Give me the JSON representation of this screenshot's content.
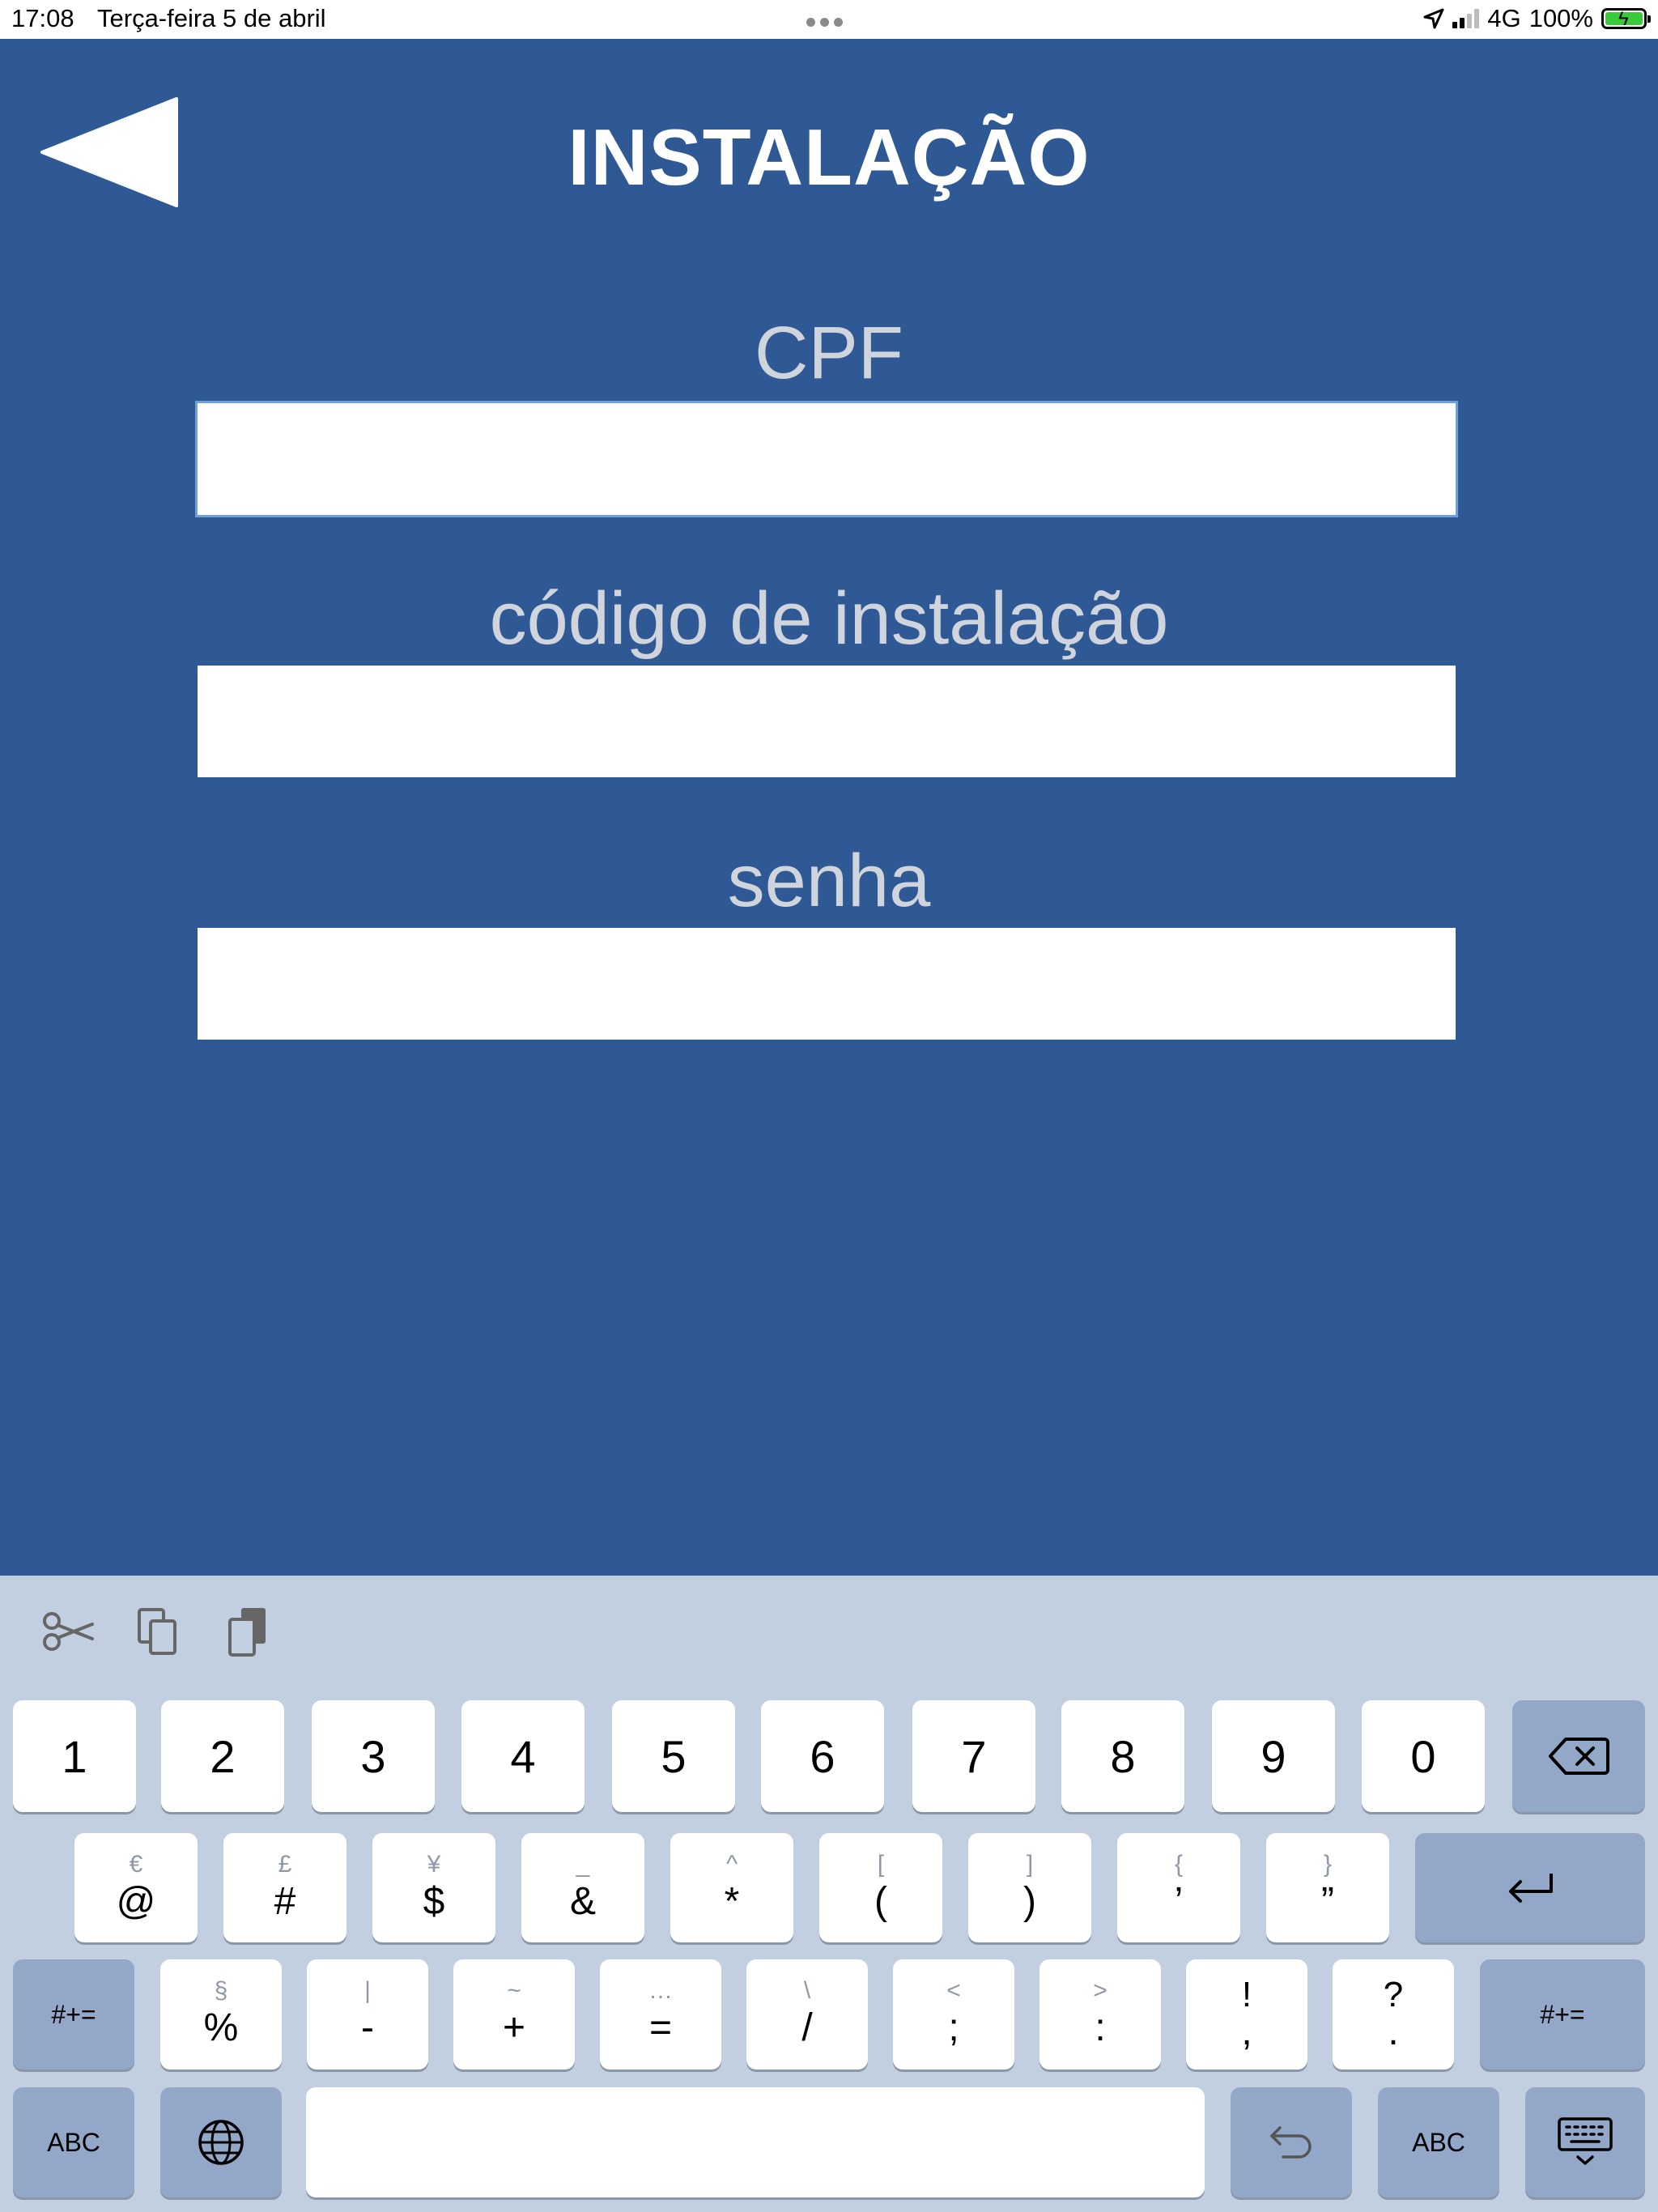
{
  "status_bar": {
    "time": "17:08",
    "date": "Terça-feira 5 de abril",
    "network": "4G",
    "battery": "100%"
  },
  "header": {
    "title": "INSTALAÇÃO",
    "back_icon": "back-triangle-icon"
  },
  "form": {
    "fields": [
      {
        "label": "CPF",
        "value": ""
      },
      {
        "label": "código de instalação",
        "value": ""
      },
      {
        "label": "senha",
        "value": ""
      }
    ]
  },
  "keyboard": {
    "shortcuts": [
      "scissors-icon",
      "copy-icon",
      "paste-icon"
    ],
    "row1": [
      "1",
      "2",
      "3",
      "4",
      "5",
      "6",
      "7",
      "8",
      "9",
      "0"
    ],
    "row2": [
      {
        "alt": "€",
        "main": "@"
      },
      {
        "alt": "£",
        "main": "#"
      },
      {
        "alt": "¥",
        "main": "$"
      },
      {
        "alt": "_",
        "main": "&"
      },
      {
        "alt": "^",
        "main": "*"
      },
      {
        "alt": "[",
        "main": "("
      },
      {
        "alt": "]",
        "main": ")"
      },
      {
        "alt": "{",
        "main": "’"
      },
      {
        "alt": "}",
        "main": "”"
      }
    ],
    "row3": [
      {
        "alt": "§",
        "main": "%"
      },
      {
        "alt": "|",
        "main": "-"
      },
      {
        "alt": "~",
        "main": "+"
      },
      {
        "alt": "…",
        "main": "="
      },
      {
        "alt": "\\",
        "main": "/"
      },
      {
        "alt": "<",
        "main": ";"
      },
      {
        "alt": ">",
        "main": ":"
      },
      {
        "alt": "!",
        "main": ","
      },
      {
        "alt": "?",
        "main": "."
      }
    ],
    "shift_label": "#+=",
    "abc_label": "ABC",
    "icons": {
      "delete": "backspace-icon",
      "return": "return-icon",
      "globe": "globe-icon",
      "undo": "undo-icon",
      "dismiss": "keyboard-dismiss-icon"
    }
  }
}
